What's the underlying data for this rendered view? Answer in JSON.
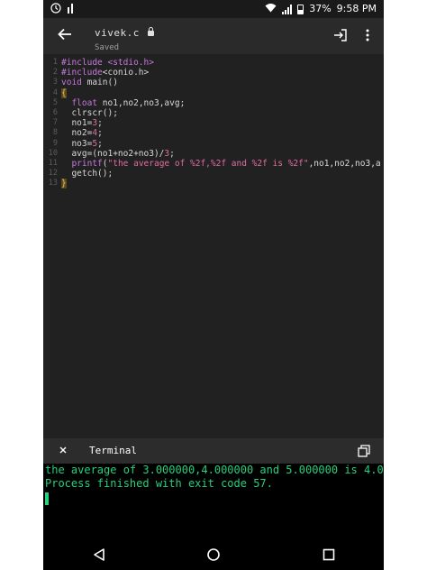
{
  "status_bar": {
    "battery": "37%",
    "time": "9:58 PM"
  },
  "app_bar": {
    "file_name": "vivek.c",
    "save_status": "Saved"
  },
  "editor": {
    "line_numbers": [
      "1",
      "2",
      "3",
      "4",
      "5",
      "6",
      "7",
      "8",
      "9",
      "10",
      "11",
      "12",
      "13"
    ],
    "lines": [
      [
        {
          "t": "#include <stdio.h>",
          "c": "pp"
        }
      ],
      [
        {
          "t": "#include",
          "c": "pp"
        },
        {
          "t": "<conio.h>",
          "c": "pl"
        }
      ],
      [
        {
          "t": "void",
          "c": "kw"
        },
        {
          "t": " main()",
          "c": "pl"
        }
      ],
      [
        {
          "t": "{",
          "c": "brace"
        }
      ],
      [
        {
          "t": "  ",
          "c": "pl"
        },
        {
          "t": "float",
          "c": "kw"
        },
        {
          "t": " no1,no2,no3,avg;",
          "c": "pl"
        }
      ],
      [
        {
          "t": "  clrscr();",
          "c": "pl"
        }
      ],
      [
        {
          "t": "  no1=",
          "c": "pl"
        },
        {
          "t": "3",
          "c": "num"
        },
        {
          "t": ";",
          "c": "pl"
        }
      ],
      [
        {
          "t": "  no2=",
          "c": "pl"
        },
        {
          "t": "4",
          "c": "num"
        },
        {
          "t": ";",
          "c": "pl"
        }
      ],
      [
        {
          "t": "  no3=",
          "c": "pl"
        },
        {
          "t": "5",
          "c": "num"
        },
        {
          "t": ";",
          "c": "pl"
        }
      ],
      [
        {
          "t": "  avg=(no1+no2+no3)/",
          "c": "pl"
        },
        {
          "t": "3",
          "c": "num"
        },
        {
          "t": ";",
          "c": "pl"
        }
      ],
      [
        {
          "t": "  ",
          "c": "pl"
        },
        {
          "t": "printf",
          "c": "kw"
        },
        {
          "t": "(",
          "c": "pl"
        },
        {
          "t": "\"the average of %2f,%2f and %2f is %2f\"",
          "c": "str"
        },
        {
          "t": ",no1,no2,no3,a",
          "c": "pl"
        }
      ],
      [
        {
          "t": "  getch();",
          "c": "pl"
        }
      ],
      [
        {
          "t": "}",
          "c": "brace"
        }
      ]
    ]
  },
  "terminal": {
    "title": "Terminal",
    "output": [
      "the average of 3.000000,4.000000 and 5.000000 is 4.0",
      "Process finished with exit code 57."
    ]
  },
  "colors": {
    "background": "#212121",
    "terminal_text": "#26d07c",
    "keyword": "#c678dd",
    "string": "#e06c9f"
  }
}
